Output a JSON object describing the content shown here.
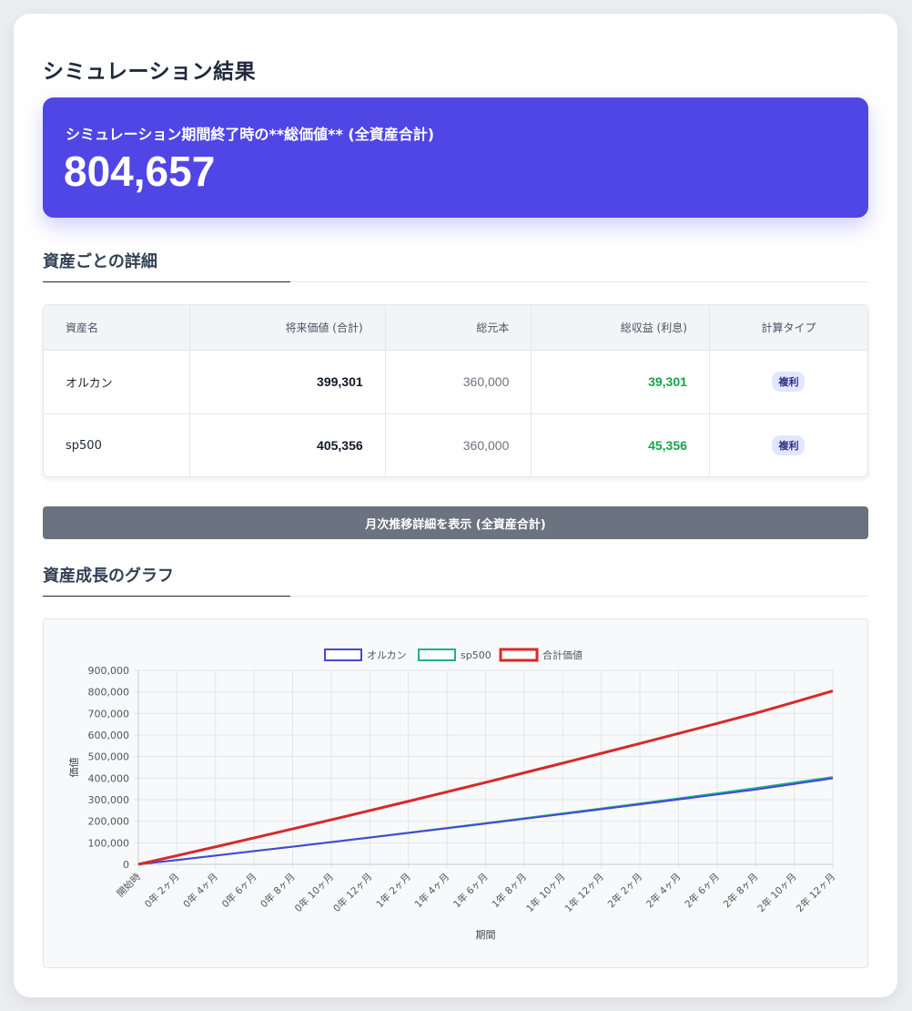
{
  "page": {
    "title": "シミュレーション結果"
  },
  "summary": {
    "label": "シミュレーション期間終了時の**総価値** (全資産合計)",
    "value": "804,657"
  },
  "details": {
    "title": "資産ごとの詳細",
    "columns": [
      "資産名",
      "将来価値 (合計)",
      "総元本",
      "総収益 (利息)",
      "計算タイプ"
    ],
    "rows": [
      {
        "name": "オルカン",
        "future_value": "399,301",
        "principal": "360,000",
        "gain": "39,301",
        "type": "複利"
      },
      {
        "name": "sp500",
        "future_value": "405,356",
        "principal": "360,000",
        "gain": "45,356",
        "type": "複利"
      }
    ]
  },
  "monthly_button": {
    "label": "月次推移詳細を表示 (全資産合計)"
  },
  "graph": {
    "title": "資産成長のグラフ"
  },
  "colors": {
    "accent": "#5046e5",
    "gain": "#16a34a",
    "orukan": "#4747d6",
    "sp500": "#1ab38a",
    "total": "#d62a2a"
  },
  "chart_data": {
    "type": "line",
    "xlabel": "期間",
    "ylabel": "価値",
    "ylim": [
      0,
      900000
    ],
    "y_ticks": [
      "0",
      "100,000",
      "200,000",
      "300,000",
      "400,000",
      "500,000",
      "600,000",
      "700,000",
      "800,000",
      "900,000"
    ],
    "y_tick_values": [
      0,
      100000,
      200000,
      300000,
      400000,
      500000,
      600000,
      700000,
      800000,
      900000
    ],
    "x_tick_labels": [
      "開始時",
      "0年 2ヶ月",
      "0年 4ヶ月",
      "0年 6ヶ月",
      "0年 8ヶ月",
      "0年 10ヶ月",
      "0年 12ヶ月",
      "1年 2ヶ月",
      "1年 4ヶ月",
      "1年 6ヶ月",
      "1年 8ヶ月",
      "1年 10ヶ月",
      "1年 12ヶ月",
      "2年 2ヶ月",
      "2年 4ヶ月",
      "2年 6ヶ月",
      "2年 8ヶ月",
      "2年 10ヶ月",
      "2年 12ヶ月"
    ],
    "months": [
      0,
      2,
      4,
      6,
      8,
      10,
      12,
      14,
      16,
      18,
      20,
      22,
      24,
      26,
      28,
      30,
      32,
      34,
      36
    ],
    "legend_position": "top",
    "grid": true,
    "series": [
      {
        "name": "オルカン",
        "color": "#4747d6",
        "values": [
          0,
          20200,
          40600,
          61200,
          82000,
          103000,
          124200,
          145600,
          167200,
          189000,
          211000,
          233200,
          255600,
          278200,
          301000,
          324000,
          347200,
          373000,
          399301
        ]
      },
      {
        "name": "sp500",
        "color": "#1ab38a",
        "values": [
          0,
          20300,
          40800,
          61600,
          82600,
          103800,
          125300,
          147000,
          169000,
          191200,
          213700,
          236400,
          259400,
          282600,
          306100,
          329800,
          353800,
          379400,
          405356
        ]
      },
      {
        "name": "合計価値",
        "color": "#d62a2a",
        "values": [
          0,
          40500,
          81400,
          122800,
          164600,
          206800,
          249500,
          292600,
          336200,
          380200,
          424700,
          469600,
          515000,
          560800,
          607100,
          653800,
          701000,
          752400,
          804657
        ]
      }
    ]
  }
}
